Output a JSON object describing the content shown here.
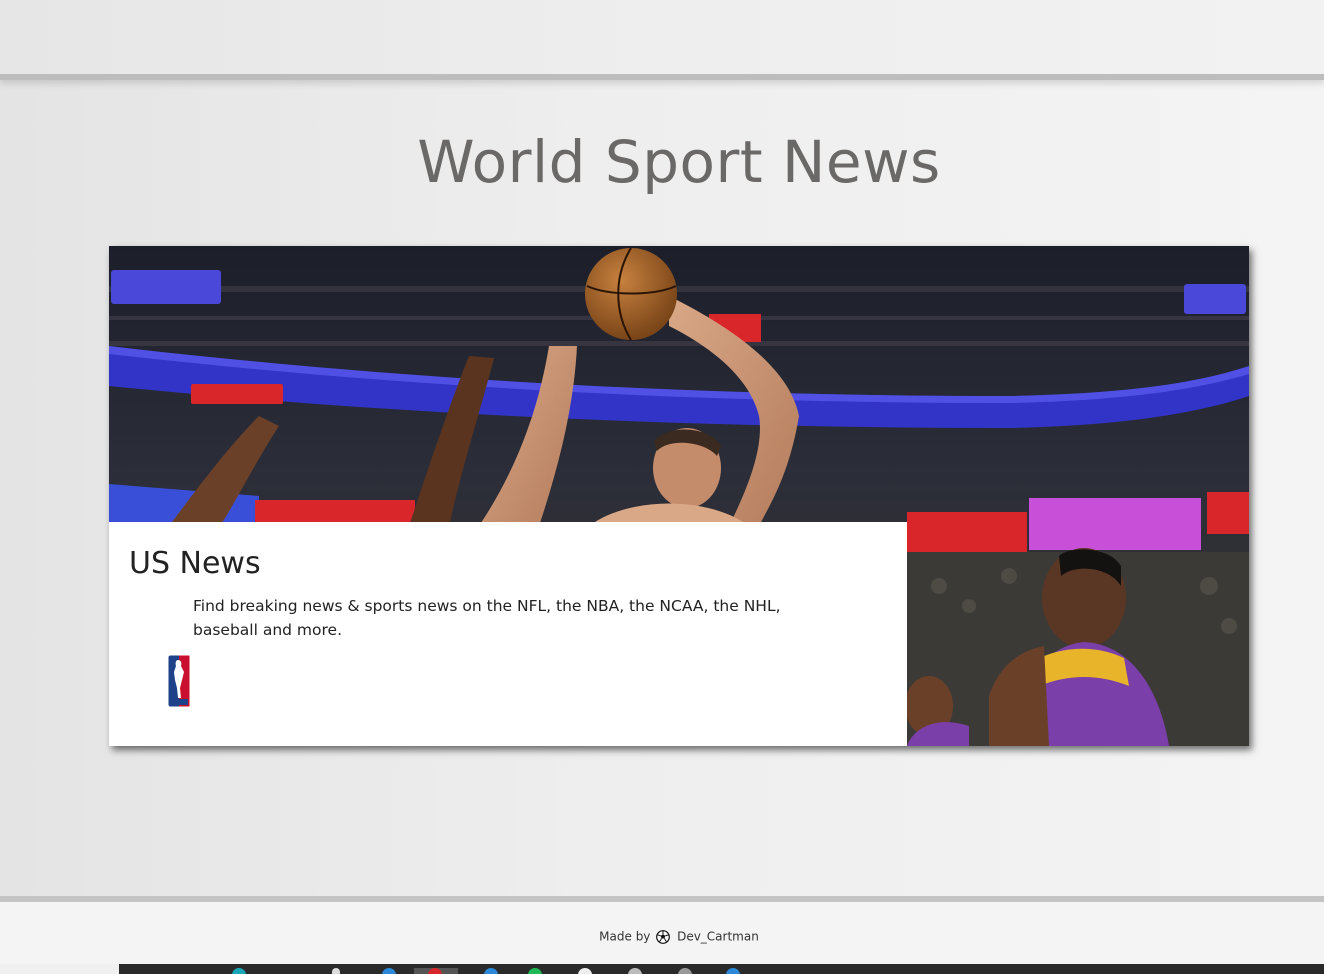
{
  "header": {
    "title": "World Sport News"
  },
  "card": {
    "title": "US News",
    "description": "Find breaking news & sports news on the NFL, the NBA, the NCAA, the NHL, baseball and more.",
    "photo_icon": "basketball-game-photo",
    "logo_icon": "nba-logo-icon"
  },
  "footer": {
    "made_by": "Made by",
    "author": "Dev_Cartman",
    "author_icon": "soccer-ball-icon"
  },
  "colors": {
    "title": "#6b6868",
    "card_bg": "#ffffff",
    "page_bg": "#ececec"
  }
}
